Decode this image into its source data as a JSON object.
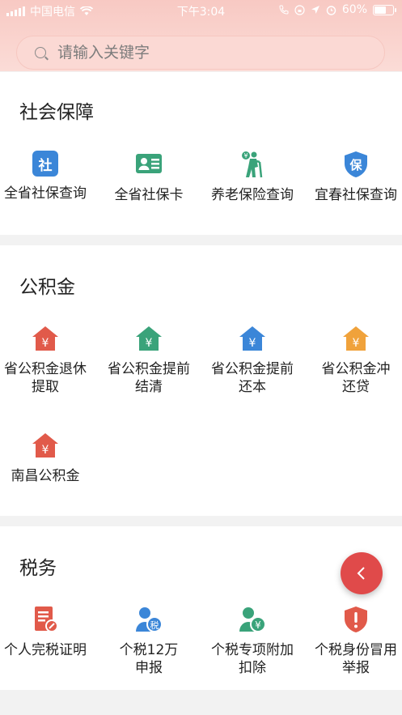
{
  "status_bar": {
    "carrier": "中国电信",
    "time": "下午3:04",
    "battery_text": "60%",
    "battery_level": 0.6
  },
  "search": {
    "placeholder": "请输入关键字"
  },
  "sections": [
    {
      "title": "社会保障",
      "items": [
        {
          "label": "全省社保查询",
          "icon": "social-security-badge-icon",
          "color": "#3b86d8",
          "glyph": "社"
        },
        {
          "label": "全省社保卡",
          "icon": "id-card-icon",
          "color": "#3aa37a"
        },
        {
          "label": "养老保险查询",
          "icon": "elderly-person-icon",
          "color": "#3aa37a"
        },
        {
          "label": "宜春社保查询",
          "icon": "shield-icon",
          "color": "#3b86d8",
          "glyph": "保"
        }
      ]
    },
    {
      "title": "公积金",
      "items": [
        {
          "label": "省公积金退休提取",
          "icon": "house-yuan-icon",
          "color": "#e15a4a"
        },
        {
          "label": "省公积金提前结清",
          "icon": "house-yuan-icon",
          "color": "#3aa37a"
        },
        {
          "label": "省公积金提前还本",
          "icon": "house-yuan-icon",
          "color": "#3b86d8"
        },
        {
          "label": "省公积金冲还贷",
          "icon": "house-yuan-icon",
          "color": "#f0a23b"
        },
        {
          "label": "南昌公积金",
          "icon": "house-yuan-icon",
          "color": "#e15a4a"
        }
      ]
    },
    {
      "title": "税务",
      "items": [
        {
          "label": "个人完税证明",
          "icon": "tax-document-icon",
          "color": "#e15a4a"
        },
        {
          "label": "个税12万申报",
          "icon": "user-tax-icon",
          "color": "#3b86d8",
          "glyph": "税"
        },
        {
          "label": "个税专项附加扣除",
          "icon": "user-yuan-icon",
          "color": "#3aa37a"
        },
        {
          "label": "个税身份冒用举报",
          "icon": "warning-shield-icon",
          "color": "#e15a4a"
        }
      ]
    }
  ],
  "fab": {
    "icon": "chevron-left-icon",
    "color": "#e04a4a"
  }
}
